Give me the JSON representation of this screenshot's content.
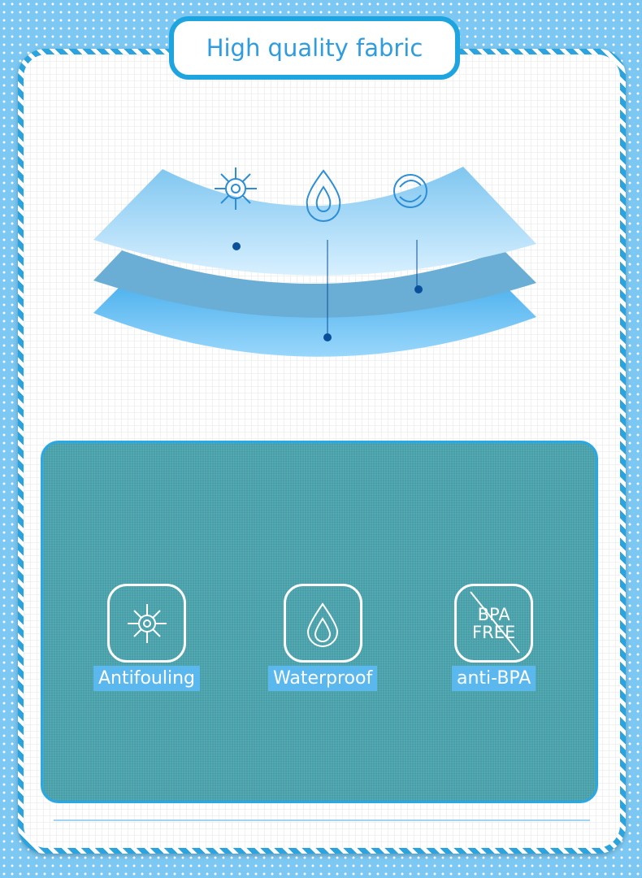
{
  "title": "High quality fabric",
  "features": [
    {
      "label": "Antifouling",
      "icon": "antibacterial-germ-icon"
    },
    {
      "label": "Waterproof",
      "icon": "water-drop-icon"
    },
    {
      "label": "anti-BPA",
      "icon": "bpa-free-icon",
      "icon_text": [
        "BPA",
        "FREE"
      ]
    }
  ],
  "colors": {
    "accent": "#1ea5e0",
    "panel": "#4aa3ad",
    "label_bg": "#5ab8ef"
  }
}
